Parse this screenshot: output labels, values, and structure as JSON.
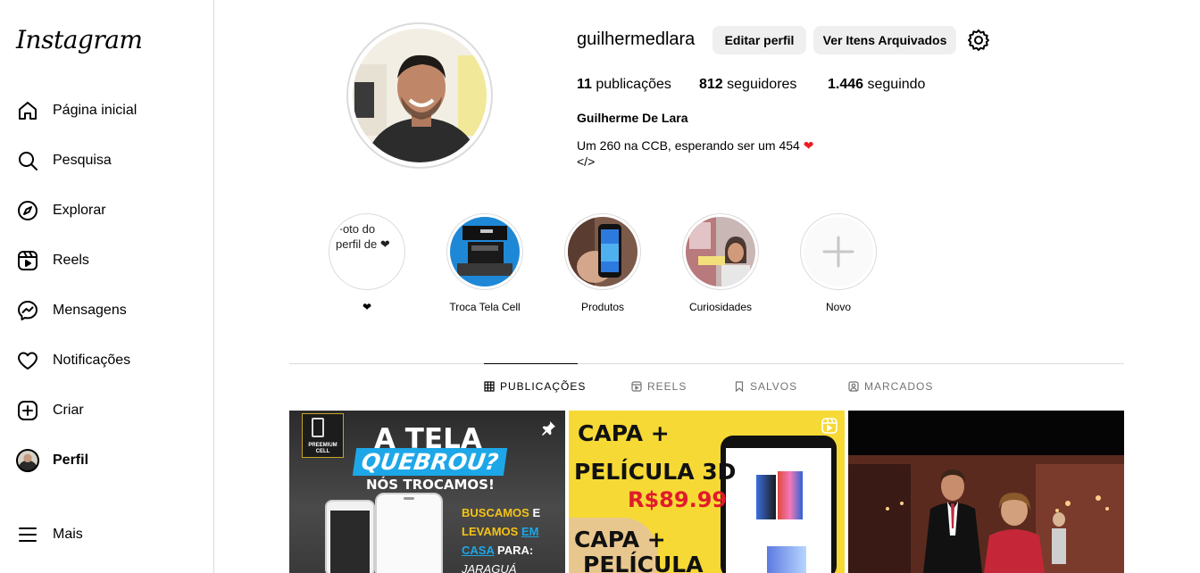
{
  "sidebar": {
    "logo": "Instagram",
    "items": [
      {
        "label": "Página inicial",
        "icon": "home-icon"
      },
      {
        "label": "Pesquisa",
        "icon": "search-icon"
      },
      {
        "label": "Explorar",
        "icon": "compass-icon"
      },
      {
        "label": "Reels",
        "icon": "reels-icon"
      },
      {
        "label": "Mensagens",
        "icon": "messenger-icon"
      },
      {
        "label": "Notificações",
        "icon": "heart-icon"
      },
      {
        "label": "Criar",
        "icon": "plus-square-icon"
      },
      {
        "label": "Perfil",
        "icon": "avatar"
      }
    ],
    "more": {
      "label": "Mais",
      "icon": "menu-icon"
    }
  },
  "profile": {
    "username": "guilhermedlara",
    "edit_label": "Editar perfil",
    "archive_label": "Ver Itens Arquivados",
    "stats": {
      "posts_count": "11",
      "posts_label": "publicações",
      "followers_count": "812",
      "followers_label": "seguidores",
      "following_count": "1.446",
      "following_label": "seguindo"
    },
    "full_name": "Guilherme De Lara",
    "bio_line1": "Um 260 na CCB, esperando ser um 454",
    "bio_line2": "</>"
  },
  "highlights": [
    {
      "caption": "❤",
      "alt": "Foto do perfil de ❤"
    },
    {
      "caption": "Troca Tela Cell"
    },
    {
      "caption": "Produtos"
    },
    {
      "caption": "Curiosidades"
    },
    {
      "caption": "Novo"
    }
  ],
  "tabs": [
    {
      "label": "PUBLICAÇÕES",
      "icon": "grid-icon",
      "active": true
    },
    {
      "label": "REELS",
      "icon": "reels-icon"
    },
    {
      "label": "SALVOS",
      "icon": "bookmark-icon"
    },
    {
      "label": "MARCADOS",
      "icon": "tag-icon"
    }
  ],
  "posts": {
    "post1": {
      "brand": "PREEMIUM CELL",
      "line1": "A TELA",
      "line2": "QUEBROU?",
      "line3": "NÓS TROCAMOS!",
      "line4a": "BUSCAMOS",
      "line4b": "E",
      "line5a": "LEVAMOS",
      "line5b": "EM",
      "line6a": "CASA",
      "line6b": "PARA:",
      "line7": "JARAGUÁ"
    },
    "post2": {
      "line1": "CAPA +",
      "line2": "PELÍCULA 3D",
      "price": "R$89.99",
      "line3": "CAPA +",
      "line4": "PELÍCULA"
    }
  },
  "colors": {
    "accent": "#ed1c24",
    "border": "#dbdbdb",
    "button_bg": "#efefef",
    "muted": "#737373"
  }
}
